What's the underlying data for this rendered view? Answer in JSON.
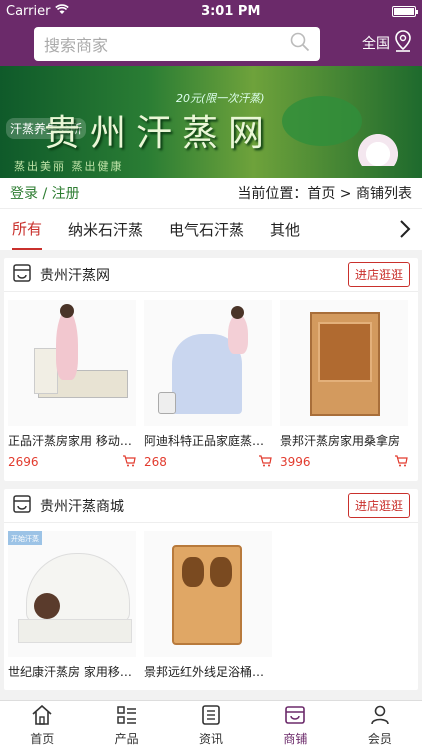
{
  "status": {
    "carrier": "Carrier",
    "time": "3:01 PM"
  },
  "header": {
    "search_placeholder": "搜索商家",
    "region": "全国"
  },
  "banner": {
    "title": "贵州汗蒸网",
    "tag": "汗蒸养生会所",
    "price_note": "20元(限一次汗蒸)",
    "slogan": "蒸出美丽   蒸出健康"
  },
  "location": {
    "login": "登录 / 注册",
    "breadcrumb": "当前位置：首页 > 商铺列表"
  },
  "tabs": [
    {
      "label": "所有"
    },
    {
      "label": "纳米石汗蒸"
    },
    {
      "label": "电气石汗蒸"
    },
    {
      "label": "其他"
    }
  ],
  "shops": [
    {
      "name": "贵州汗蒸网",
      "enter_label": "进店逛逛",
      "products": [
        {
          "name": "正品汗蒸房家用 移动汗蒸箱",
          "price": "2696"
        },
        {
          "name": "阿迪科特正品家庭蒸汽浴箱",
          "price": "268"
        },
        {
          "name": "景邦汗蒸房家用桑拿房",
          "price": "3996"
        }
      ]
    },
    {
      "name": "贵州汗蒸商城",
      "enter_label": "进店逛逛",
      "products": [
        {
          "name": "世纪康汗蒸房 家用移动汗蒸",
          "price": "",
          "badge": "开始汗蒸"
        },
        {
          "name": "景邦远红外线足浴桶足疗",
          "price": ""
        }
      ]
    }
  ],
  "tabbar": [
    {
      "label": "首页",
      "icon": "home-icon"
    },
    {
      "label": "产品",
      "icon": "list-icon"
    },
    {
      "label": "资讯",
      "icon": "news-icon"
    },
    {
      "label": "商铺",
      "icon": "shop-icon"
    },
    {
      "label": "会员",
      "icon": "user-icon"
    }
  ],
  "colors": {
    "primary": "#6b2a6a",
    "accent": "#c9302c",
    "price": "#e23b2e",
    "login": "#2e7d32"
  }
}
